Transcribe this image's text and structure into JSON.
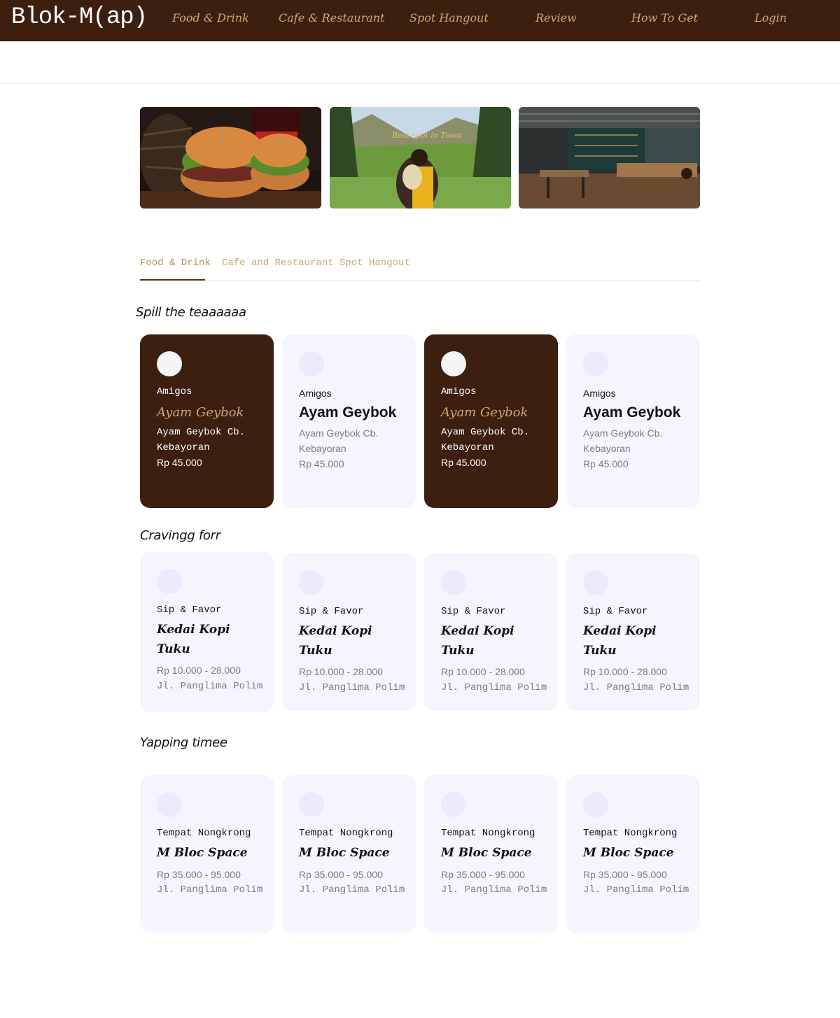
{
  "nav": {
    "brand": "Blok-M(ap)",
    "links": [
      "Food & Drink",
      "Cafe & Restaurant",
      "Spot Hangout",
      "Review",
      "How To Get",
      "Login"
    ]
  },
  "hero": {
    "overlay_text": "Best spot in Town"
  },
  "tabs": [
    {
      "label": "Food & Drink",
      "active": true
    },
    {
      "label": "Cafe and Restaurant",
      "active": false
    },
    {
      "label": "Spot Hangout",
      "active": false
    }
  ],
  "sections": [
    {
      "title": "Spill the teaaaaaa",
      "cards": [
        {
          "label": "Amigos",
          "name": "Ayam Geybok",
          "desc_1": "Ayam Geybok Cb.",
          "desc_2": "Kebayoran",
          "price": "Rp 45.000",
          "dark": true
        },
        {
          "label": "Amigos",
          "name": "Ayam Geybok",
          "desc_1": "Ayam Geybok Cb.",
          "desc_2": "Kebayoran",
          "price": "Rp 45.000",
          "dark": false
        },
        {
          "label": "Amigos",
          "name": "Ayam Geybok",
          "desc_1": "Ayam Geybok Cb.",
          "desc_2": "Kebayoran",
          "price": "Rp 45.000",
          "dark": true
        },
        {
          "label": "Amigos",
          "name": "Ayam Geybok",
          "desc_1": "Ayam Geybok Cb.",
          "desc_2": "Kebayoran",
          "price": "Rp 45.000",
          "dark": false
        }
      ]
    },
    {
      "title": "Cravingg forr",
      "cards": [
        {
          "label": "Sip & Favor",
          "name_1": "Kedai Kopi",
          "name_2": "Tuku",
          "price": "Rp 10.000 - 28.000",
          "address": "Jl. Panglima Polim"
        },
        {
          "label": "Sip & Favor",
          "name_1": "Kedai Kopi",
          "name_2": "Tuku",
          "price": "Rp 10.000 - 28.000",
          "address": "Jl. Panglima Polim"
        },
        {
          "label": "Sip & Favor",
          "name_1": "Kedai Kopi",
          "name_2": "Tuku",
          "price": "Rp 10.000 - 28.000",
          "address": "Jl. Panglima Polim"
        },
        {
          "label": "Sip & Favor",
          "name_1": "Kedai Kopi",
          "name_2": "Tuku",
          "price": "Rp 10.000 - 28.000",
          "address": "Jl. Panglima Polim"
        }
      ]
    },
    {
      "title": "Yapping timee",
      "cards": [
        {
          "label": "Tempat Nongkrong",
          "name": "M Bloc Space",
          "price": "Rp 35.000 - 95.000",
          "address": "Jl. Panglima Polim"
        },
        {
          "label": "Tempat Nongkrong",
          "name": "M Bloc Space",
          "price": "Rp 35.000 - 95.000",
          "address": "Jl. Panglima Polim"
        },
        {
          "label": "Tempat Nongkrong",
          "name": "M Bloc Space",
          "price": "Rp 35.000 - 95.000",
          "address": "Jl. Panglima Polim"
        },
        {
          "label": "Tempat Nongkrong",
          "name": "M Bloc Space",
          "price": "Rp 35.000 - 95.000",
          "address": "Jl. Panglima Polim"
        }
      ]
    }
  ],
  "colors": {
    "brand_brown": "#3d1f10",
    "gold": "#c9ab72",
    "card_light": "#f6f5fd"
  }
}
